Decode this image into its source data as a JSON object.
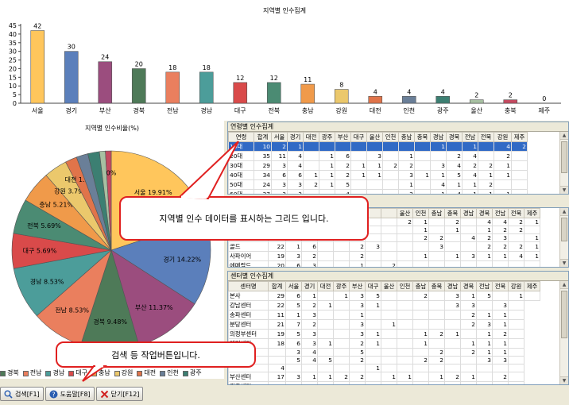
{
  "bar_chart": {
    "title": "지역별 인수집계",
    "yticks": [
      0,
      5,
      10,
      15,
      20,
      25,
      30,
      35,
      40,
      45
    ]
  },
  "chart_data": [
    {
      "type": "bar",
      "title": "지역별 인수집계",
      "categories": [
        "서울",
        "경기",
        "부산",
        "경북",
        "전남",
        "경남",
        "대구",
        "전북",
        "충남",
        "강원",
        "대전",
        "인천",
        "광주",
        "울산",
        "충북",
        "제주"
      ],
      "values": [
        42,
        30,
        24,
        20,
        18,
        18,
        12,
        12,
        11,
        8,
        4,
        4,
        4,
        2,
        2,
        0
      ],
      "colors": [
        "#ffc65c",
        "#5b7fbb",
        "#9b4d7e",
        "#4e7a58",
        "#ea7f5e",
        "#4c9d9a",
        "#d94a4a",
        "#4b8b73",
        "#f09a4a",
        "#ebc86c",
        "#e0744a",
        "#6a7f98",
        "#3c7f72",
        "#a7c0a2",
        "#c44a60",
        "#888888"
      ],
      "ylim": [
        0,
        45
      ],
      "grid": false
    },
    {
      "type": "pie",
      "title": "지역별 인수비율(%)",
      "categories": [
        "서울",
        "경기",
        "부산",
        "경북",
        "전남",
        "경남",
        "대구",
        "전북",
        "충남",
        "강원",
        "대전",
        "인천",
        "광주",
        "울산",
        "충북",
        "제주"
      ],
      "values": [
        19.91,
        14.22,
        11.37,
        9.48,
        8.53,
        8.53,
        5.69,
        5.69,
        5.21,
        3.79,
        1.9,
        1.9,
        1.9,
        0.95,
        0.95,
        0
      ],
      "labels": [
        "서울 19.91%",
        "경기 14.22%",
        "부산 11.37%",
        "경북 9.48%",
        "전남 8.53%",
        "경남 8.53%",
        "대구 5.69%",
        "전북 5.69%",
        "충남 5.21%",
        "강원 3.79%",
        "대전 1.9%",
        "",
        "",
        "",
        "",
        "0%"
      ]
    }
  ],
  "grid1": {
    "caption": "연령별 인수집계",
    "headers": [
      "연령",
      "합계",
      "서울",
      "경기",
      "대전",
      "광주",
      "부산",
      "대구",
      "울산",
      "인천",
      "충남",
      "충북",
      "경남",
      "경북",
      "전남",
      "전북",
      "강원",
      "제주"
    ],
    "rows": [
      [
        "10대",
        "10",
        "2",
        "1",
        "",
        "",
        "",
        "",
        "",
        "",
        "",
        "",
        "1",
        "",
        "1",
        "",
        "4",
        "2"
      ],
      [
        "20대",
        "35",
        "11",
        "4",
        "",
        "1",
        "6",
        "",
        "3",
        "",
        "1",
        "",
        "",
        "2",
        "4",
        "",
        "2",
        ""
      ],
      [
        "30대",
        "29",
        "3",
        "4",
        "",
        "1",
        "2",
        "1",
        "1",
        "2",
        "2",
        "",
        "3",
        "4",
        "2",
        "2",
        "1",
        ""
      ],
      [
        "40대",
        "34",
        "6",
        "6",
        "1",
        "1",
        "2",
        "1",
        "1",
        "",
        "3",
        "1",
        "1",
        "5",
        "4",
        "1",
        "1",
        ""
      ],
      [
        "50대",
        "24",
        "3",
        "3",
        "2",
        "1",
        "5",
        "",
        "",
        "",
        "1",
        "",
        "4",
        "1",
        "1",
        "2",
        "",
        ""
      ],
      [
        "60대",
        "27",
        "3",
        "3",
        "",
        "",
        "4",
        "",
        "",
        "",
        "2",
        "",
        "1",
        "4",
        "1",
        "1",
        "1",
        ""
      ]
    ]
  },
  "grid2": {
    "headers": [
      "",
      "",
      "",
      "",
      "",
      "",
      "",
      "",
      "",
      "울산",
      "인천",
      "충남",
      "충북",
      "경남",
      "경북",
      "전남",
      "전북",
      "제주"
    ],
    "rows": [
      [
        "",
        "",
        "",
        "",
        "",
        "",
        "",
        "",
        "",
        "2",
        "1",
        "",
        "2",
        "",
        "4",
        "4",
        "2",
        "1"
      ],
      [
        "",
        "",
        "",
        "",
        "",
        "",
        "",
        "",
        "",
        "",
        "1",
        "",
        "1",
        "",
        "1",
        "2",
        "2",
        ""
      ],
      [
        "",
        "",
        "",
        "",
        "",
        "",
        "",
        "",
        "",
        "",
        "2",
        "2",
        "",
        "4",
        "2",
        "3",
        "",
        "1"
      ],
      [
        "골드",
        "22",
        "1",
        "6",
        "",
        "",
        "2",
        "3",
        "",
        "",
        "",
        "3",
        "",
        "",
        "2",
        "2",
        "2",
        "1"
      ],
      [
        "사파이어",
        "19",
        "3",
        "2",
        "",
        "",
        "2",
        "",
        "",
        "",
        "1",
        "",
        "1",
        "3",
        "1",
        "1",
        "4",
        "1"
      ],
      [
        "에메랄드",
        "20",
        "6",
        "3",
        "",
        "",
        "1",
        "",
        "2",
        "",
        "",
        "",
        "",
        "",
        "",
        "",
        "",
        ""
      ]
    ]
  },
  "grid3": {
    "caption": "센터별 인수집계",
    "headers": [
      "센터명",
      "합계",
      "서울",
      "경기",
      "대전",
      "광주",
      "부산",
      "대구",
      "울산",
      "인천",
      "충남",
      "충북",
      "경남",
      "경북",
      "전남",
      "전북",
      "강원",
      "제주"
    ],
    "rows": [
      [
        "본사",
        "29",
        "6",
        "1",
        "",
        "1",
        "3",
        "5",
        "",
        "",
        "2",
        "",
        "3",
        "1",
        "5",
        "",
        "1",
        ""
      ],
      [
        "강남센터",
        "22",
        "5",
        "2",
        "1",
        "",
        "3",
        "1",
        "",
        "",
        "",
        "",
        "3",
        "3",
        "",
        "3",
        ""
      ],
      [
        "송파센터",
        "11",
        "1",
        "3",
        "",
        "",
        "1",
        "",
        "",
        "",
        "",
        "",
        "",
        "2",
        "1",
        "1",
        ""
      ],
      [
        "분당센터",
        "21",
        "7",
        "2",
        "",
        "",
        "3",
        "",
        "1",
        "",
        "",
        "",
        "",
        "2",
        "3",
        "1",
        ""
      ],
      [
        "의정부센터",
        "19",
        "5",
        "3",
        "",
        "",
        "3",
        "1",
        "",
        "",
        "1",
        "2",
        "1",
        "",
        "1",
        "2",
        ""
      ],
      [
        "대전센터",
        "18",
        "6",
        "3",
        "1",
        "",
        "2",
        "1",
        "",
        "",
        "1",
        "",
        "",
        "1",
        "1",
        "1",
        ""
      ],
      [
        "",
        "",
        "3",
        "4",
        "",
        "",
        "5",
        "",
        "",
        "",
        "",
        "2",
        "",
        "2",
        "1",
        "1",
        ""
      ],
      [
        "",
        "",
        "5",
        "4",
        "5",
        "",
        "2",
        "",
        "",
        "",
        "2",
        "2",
        "",
        "",
        "3",
        "3",
        ""
      ],
      [
        "",
        "4",
        "",
        "",
        "",
        "",
        "",
        "1",
        "",
        "",
        "",
        "",
        "",
        "",
        "",
        "",
        ""
      ],
      [
        "부산센터",
        "17",
        "3",
        "1",
        "1",
        "2",
        "2",
        "",
        "1",
        "1",
        "",
        "1",
        "2",
        "1",
        "",
        "2",
        ""
      ],
      [
        "광주센터",
        "16",
        "1",
        "2",
        "",
        "1",
        "",
        "1",
        "",
        "",
        "",
        "",
        "",
        "",
        "",
        "",
        ""
      ]
    ]
  },
  "callout_grid": "지역별 인수 데이터를 표시하는 그리드 입니다.",
  "callout_toolbar": "검색 등 작업버튼입니다.",
  "legend": [
    {
      "label": "경북",
      "color": "#4e7a58"
    },
    {
      "label": "전남",
      "color": "#ea7f5e"
    },
    {
      "label": "경남",
      "color": "#4c9d9a"
    },
    {
      "label": "대구",
      "color": "#d94a4a"
    },
    {
      "label": "충남",
      "color": "#f09a4a"
    },
    {
      "label": "강원",
      "color": "#ebc86c"
    },
    {
      "label": "대전",
      "color": "#e0744a"
    },
    {
      "label": "인천",
      "color": "#6a7f98"
    },
    {
      "label": "광주",
      "color": "#3c7f72"
    }
  ],
  "toolbar": {
    "search": "검색[F1]",
    "help": "도움말[F8]",
    "close": "닫기[F12]"
  }
}
